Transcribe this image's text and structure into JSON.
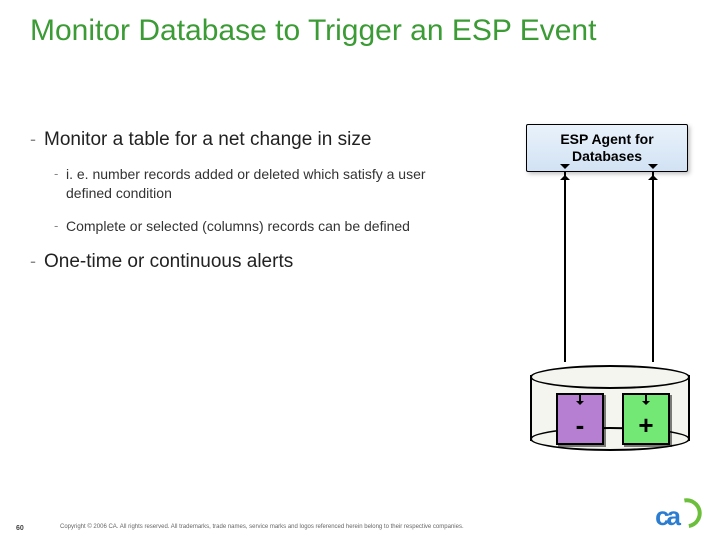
{
  "slide": {
    "title": "Monitor Database to Trigger an ESP Event",
    "bullets": [
      {
        "text": "Monitor a table for a net change in size",
        "children": [
          {
            "text": "i. e. number records added or deleted which satisfy a user defined condition"
          },
          {
            "text": "Complete or selected (columns) records can be defined"
          }
        ]
      },
      {
        "text": "One-time or continuous alerts",
        "children": []
      }
    ]
  },
  "agent_box": "ESP Agent for\nDatabases",
  "db": {
    "minus_sign": "-",
    "plus_sign": "+"
  },
  "footer": {
    "page_number": "60",
    "copyright": "Copyright © 2006 CA. All rights reserved. All trademarks, trade names, service marks and logos referenced herein belong to their respective companies."
  }
}
